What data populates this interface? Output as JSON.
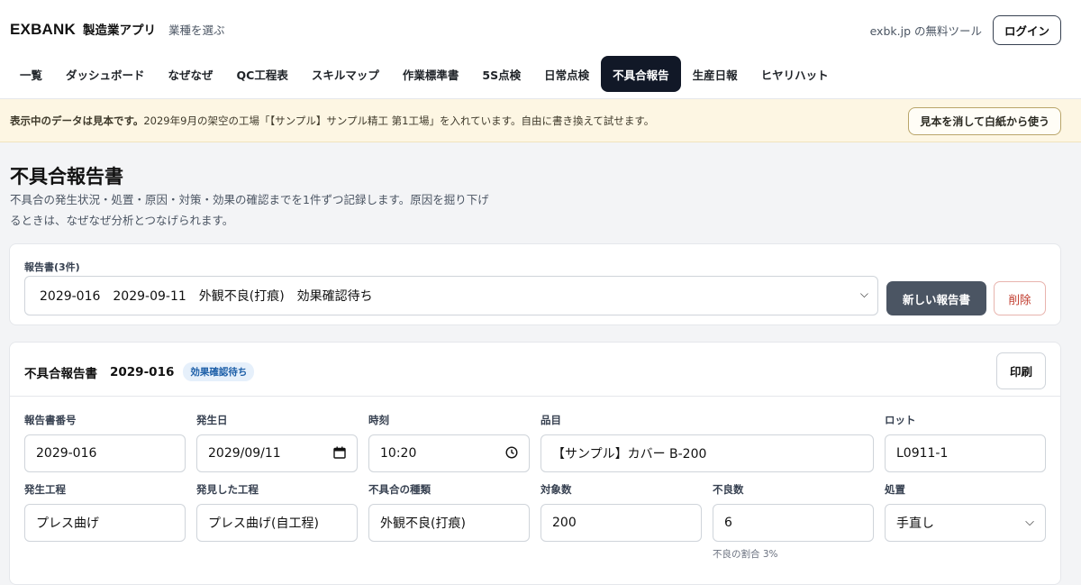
{
  "header": {
    "logo": "EXBANK",
    "app_name": "製造業アプリ",
    "industry_link": "業種を選ぶ",
    "site_text": "exbk.jp の無料ツール",
    "login_label": "ログイン"
  },
  "nav": {
    "tabs": [
      {
        "label": "一覧"
      },
      {
        "label": "ダッシュボード"
      },
      {
        "label": "なぜなぜ"
      },
      {
        "label": "QC工程表"
      },
      {
        "label": "スキルマップ"
      },
      {
        "label": "作業標準書"
      },
      {
        "label": "5S点検"
      },
      {
        "label": "日常点検"
      },
      {
        "label": "不具合報告",
        "active": true
      },
      {
        "label": "生産日報"
      },
      {
        "label": "ヒヤリハット"
      }
    ]
  },
  "banner": {
    "bold_text": "表示中のデータは見本です。",
    "text": "2029年9月の架空の工場「【サンプル】サンプル精工 第1工場」を入れています。自由に書き換えて試せます。",
    "reset_label": "見本を消して白紙から使う"
  },
  "page": {
    "title": "不具合報告書",
    "description": "不具合の発生状況・処置・原因・対策・効果の確認までを1件ずつ記録します。原因を掘り下げるときは、なぜなぜ分析とつなげられます。"
  },
  "report_select": {
    "label": "報告書(3件)",
    "value": "2029-016　2029-09-11　外観不良(打痕)　効果確認待ち",
    "new_label": "新しい報告書",
    "delete_label": "削除"
  },
  "report": {
    "heading": "不具合報告書",
    "number": "2029-016",
    "status": "効果確認待ち",
    "print_label": "印刷",
    "fields": {
      "report_no": {
        "label": "報告書番号",
        "value": "2029-016"
      },
      "date": {
        "label": "発生日",
        "value": "2029/09/11"
      },
      "time": {
        "label": "時刻",
        "value": "10:20"
      },
      "item": {
        "label": "品目",
        "value": "【サンプル】カバー B-200"
      },
      "lot": {
        "label": "ロット",
        "value": "L0911-1"
      },
      "process": {
        "label": "発生工程",
        "value": "プレス曲げ"
      },
      "found_process": {
        "label": "発見した工程",
        "value": "プレス曲げ(自工程)"
      },
      "defect_type": {
        "label": "不具合の種類",
        "value": "外観不良(打痕)"
      },
      "target_qty": {
        "label": "対象数",
        "value": "200"
      },
      "defect_qty": {
        "label": "不良数",
        "value": "6",
        "hint": "不良の割合 3%"
      },
      "disposition": {
        "label": "処置",
        "value": "手直し"
      }
    }
  },
  "colors": {
    "active_tab": "#111827",
    "banner_bg": "#fdf6e3",
    "badge_text": "#1d5fa8",
    "delete_text": "#c0392b"
  }
}
